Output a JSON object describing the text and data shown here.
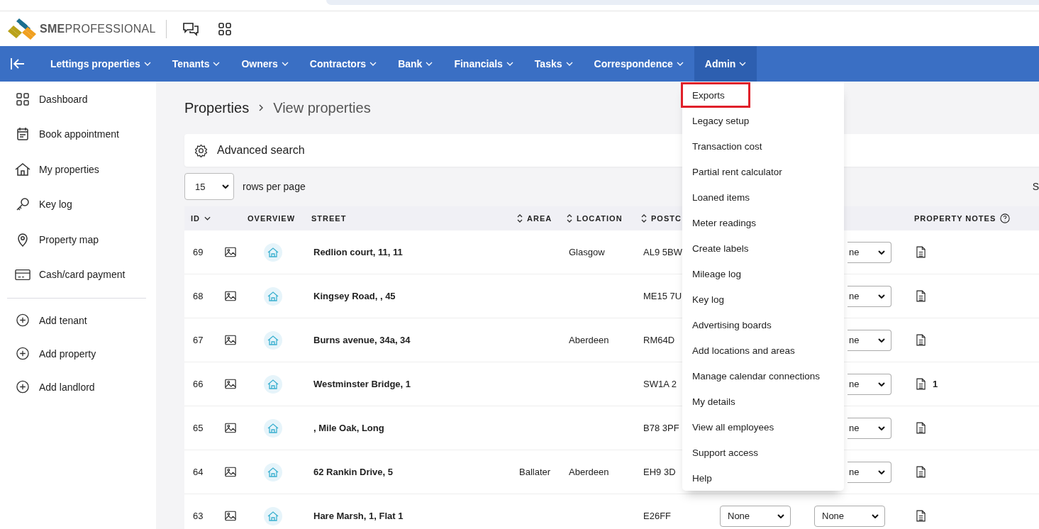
{
  "brand": "**SME**PROFESSIONAL",
  "nav": [
    {
      "label": "Lettings properties",
      "selected": false
    },
    {
      "label": "Tenants",
      "selected": false
    },
    {
      "label": "Owners",
      "selected": false
    },
    {
      "label": "Contractors",
      "selected": false
    },
    {
      "label": "Bank",
      "selected": false
    },
    {
      "label": "Financials",
      "selected": false
    },
    {
      "label": "Tasks",
      "selected": false
    },
    {
      "label": "Correspondence",
      "selected": false
    },
    {
      "label": "Admin",
      "selected": true
    }
  ],
  "sidebar": {
    "items": [
      {
        "label": "Dashboard",
        "kind": "dashboard"
      },
      {
        "label": "Book appointment",
        "kind": "calendar"
      },
      {
        "label": "My properties",
        "kind": "house"
      },
      {
        "label": "Key log",
        "kind": "key"
      },
      {
        "label": "Property map",
        "kind": "pin"
      },
      {
        "label": "Cash/card payment",
        "kind": "card"
      }
    ],
    "actions": [
      {
        "label": "Add tenant"
      },
      {
        "label": "Add property"
      },
      {
        "label": "Add landlord"
      }
    ]
  },
  "breadcrumb": [
    "Properties",
    "View properties"
  ],
  "advanced_search": "Advanced search",
  "page_size": {
    "value": "15",
    "label": "rows per page"
  },
  "toolbar_cut_text": "S",
  "table": {
    "columns": [
      {
        "label": "ID",
        "sorted": true
      },
      {
        "label": "OVERVIEW"
      },
      {
        "label": "STREET"
      },
      {
        "label": "AREA",
        "sortable": true
      },
      {
        "label": "LOCATION",
        "sortable": true
      },
      {
        "label": "POSTC",
        "sortable": true
      },
      {
        "label": "PROPERTY NOTES",
        "help": true
      }
    ],
    "rows": [
      {
        "id": "69",
        "street": "Redlion court, 11, 11",
        "location": "Glasgow",
        "postcode": "AL9 5BW",
        "select_b": {
          "value": "ne",
          "partly_hidden": true
        }
      },
      {
        "id": "68",
        "street": "Kingsey Road, , 45",
        "postcode": "ME15 7U",
        "select_b": {
          "value": "ne",
          "partly_hidden": true
        }
      },
      {
        "id": "67",
        "street": "Burns avenue, 34a, 34",
        "location": "Aberdeen",
        "postcode": "RM64D",
        "select_b": {
          "value": "ne",
          "partly_hidden": true
        }
      },
      {
        "id": "66",
        "street": "Westminster Bridge, 1",
        "postcode": "SW1A 2",
        "select_b": {
          "value": "ne",
          "partly_hidden": true
        },
        "notes_count": "1"
      },
      {
        "id": "65",
        "street": ", Mile Oak, Long",
        "postcode": "B78 3PF",
        "select_b": {
          "value": "ne",
          "partly_hidden": true
        }
      },
      {
        "id": "64",
        "street": "62 Rankin Drive, 5",
        "area": "Ballater",
        "location": "Aberdeen",
        "postcode": "EH9 3D",
        "select_b": {
          "value": "ne",
          "partly_hidden": true
        }
      },
      {
        "id": "63",
        "street": "Hare Marsh, 1, Flat 1",
        "postcode": "E26FF",
        "select_a": {
          "value": "None"
        },
        "select_b": {
          "value": "None",
          "partly_hidden": false
        }
      }
    ]
  },
  "admin_menu": [
    {
      "label": "Exports",
      "highlighted": true
    },
    {
      "label": "Legacy setup",
      "highlighted": false
    },
    {
      "label": "Transaction cost",
      "highlighted": false
    },
    {
      "label": "Partial rent calculator",
      "highlighted": false
    },
    {
      "label": "Loaned items",
      "highlighted": false
    },
    {
      "label": "Meter readings",
      "highlighted": false
    },
    {
      "label": "Create labels",
      "highlighted": false
    },
    {
      "label": "Mileage log",
      "highlighted": false
    },
    {
      "label": "Key log",
      "highlighted": false
    },
    {
      "label": "Advertising boards",
      "highlighted": false
    },
    {
      "label": "Add locations and areas",
      "highlighted": false
    },
    {
      "label": "Manage calendar connections",
      "highlighted": false
    },
    {
      "label": "My details",
      "highlighted": false
    },
    {
      "label": "View all employees",
      "highlighted": false
    },
    {
      "label": "Support access",
      "highlighted": false
    },
    {
      "label": "Help",
      "highlighted": false
    }
  ]
}
